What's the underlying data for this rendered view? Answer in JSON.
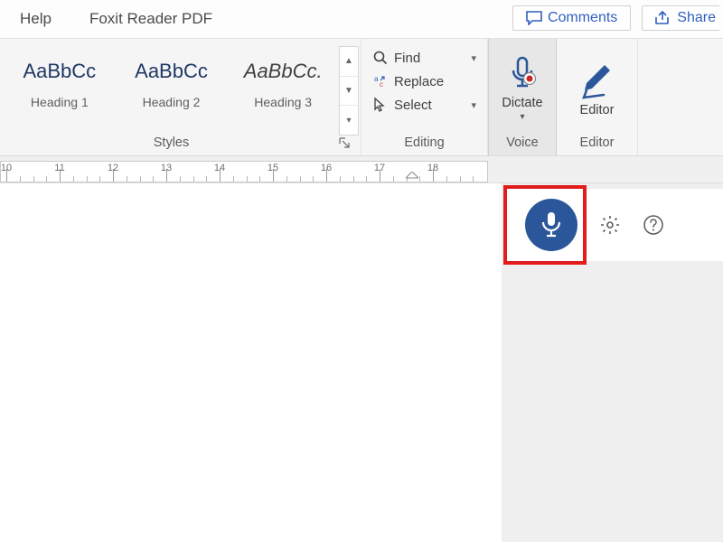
{
  "menubar": {
    "help": "Help",
    "foxit": "Foxit Reader PDF"
  },
  "top": {
    "comments": "Comments",
    "share": "Share"
  },
  "styles": {
    "label": "Styles",
    "items": [
      {
        "preview": "AaBbCc",
        "caption": "Heading 1"
      },
      {
        "preview": "AaBbCc",
        "caption": "Heading 2"
      },
      {
        "preview": "AaBbCc.",
        "caption": "Heading 3"
      }
    ]
  },
  "editing": {
    "label": "Editing",
    "find": "Find",
    "replace": "Replace",
    "select": "Select"
  },
  "voice": {
    "label": "Voice",
    "dictate": "Dictate"
  },
  "editor": {
    "label": "Editor",
    "button": "Editor"
  },
  "ruler": {
    "numbers": [
      "10",
      "11",
      "12",
      "13",
      "14",
      "15",
      "16",
      "17",
      "18"
    ]
  }
}
